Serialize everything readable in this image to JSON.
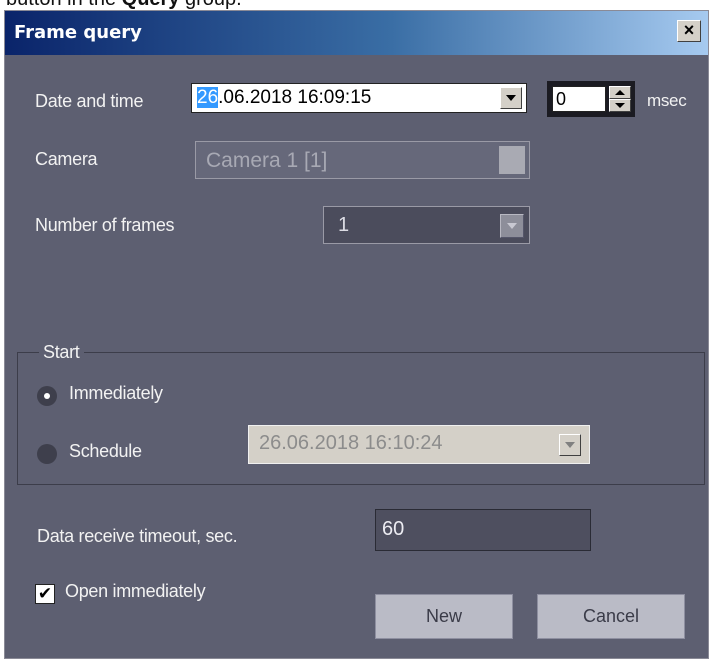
{
  "page_caption": {
    "prefix": "button in the ",
    "bold": "Query",
    "suffix": " group."
  },
  "dialog": {
    "title": "Frame query",
    "close_glyph": "×",
    "date_time": {
      "label": "Date and time",
      "value_highlight": "26",
      "value_rest": ".06.2018 16:09:15"
    },
    "msec": {
      "value": "0",
      "label": "msec"
    },
    "camera": {
      "label": "Camera",
      "value": "Camera 1 [1]"
    },
    "frames": {
      "label": "Number of frames",
      "value": "1"
    },
    "start": {
      "label": "Start",
      "options": [
        {
          "label": "Immediately",
          "selected": true
        },
        {
          "label": "Schedule",
          "selected": false
        }
      ],
      "schedule_value": "26.06.2018 16:10:24"
    },
    "timeout": {
      "label": "Data receive timeout, sec.",
      "value": "60"
    },
    "open_immediately": {
      "label": "Open immediately",
      "checked": true,
      "check_glyph": "✔"
    },
    "buttons": {
      "new": "New",
      "cancel": "Cancel"
    }
  },
  "colors": {
    "dialog_bg": "#5d5f71",
    "title_start": "#0a246a",
    "title_end": "#a6caf0",
    "highlight": "#3399ff"
  }
}
